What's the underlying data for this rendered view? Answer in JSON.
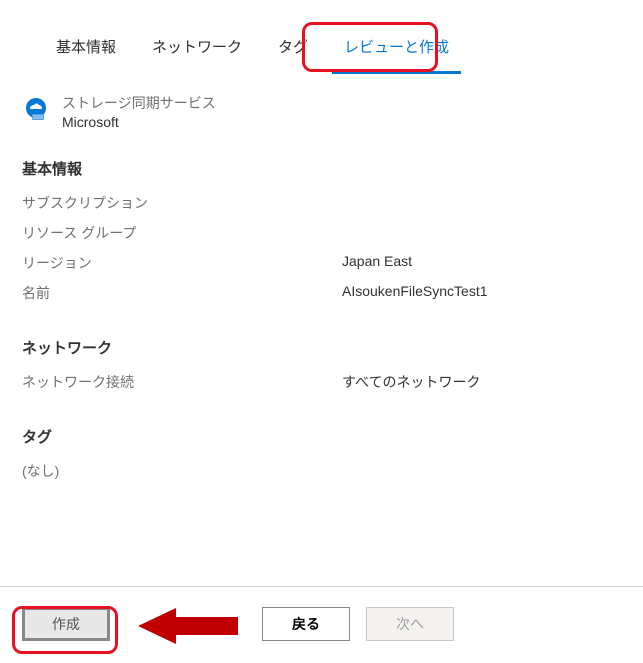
{
  "tabs": {
    "basic": "基本情報",
    "network": "ネットワーク",
    "tag": "タグ",
    "review": "レビューと作成"
  },
  "service": {
    "title": "ストレージ同期サービス",
    "publisher": "Microsoft"
  },
  "sections": {
    "basic": {
      "title": "基本情報",
      "subscription_label": "サブスクリプション",
      "subscription_value": "",
      "rg_label": "リソース グループ",
      "rg_value": "",
      "region_label": "リージョン",
      "region_value": "Japan East",
      "name_label": "名前",
      "name_value": "AIsoukenFileSyncTest1"
    },
    "network": {
      "title": "ネットワーク",
      "conn_label": "ネットワーク接続",
      "conn_value": "すべてのネットワーク"
    },
    "tag": {
      "title": "タグ",
      "none": "(なし)"
    }
  },
  "footer": {
    "create": "作成",
    "back": "戻る",
    "next": "次へ"
  }
}
